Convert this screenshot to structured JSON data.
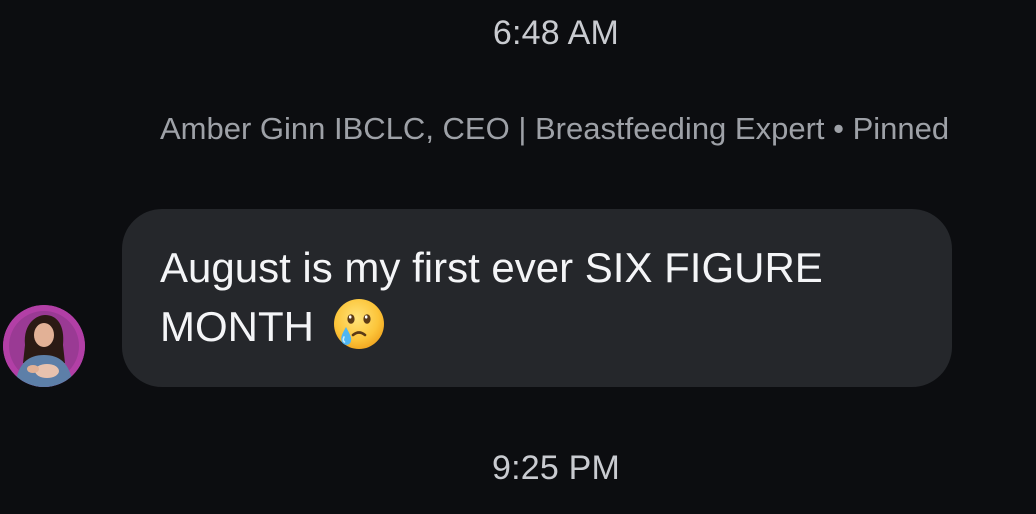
{
  "conversation": {
    "timestamp_top": "6:48 AM",
    "timestamp_bottom": "9:25 PM"
  },
  "message": {
    "sender_line": "Amber Ginn IBCLC, CEO | Breastfeeding Expert • Pinned",
    "text": "August is my first ever SIX FIGURE MONTH",
    "emoji": "face-holding-back-tears",
    "avatar": "sender-avatar-photo"
  },
  "colors": {
    "background": "#0c0d10",
    "bubble": "#25272b",
    "message_text": "#f4f5f7",
    "meta_text": "#9ea1a7",
    "timestamp_text": "#c9cbd0",
    "avatar_ring": "#b23fa6"
  }
}
